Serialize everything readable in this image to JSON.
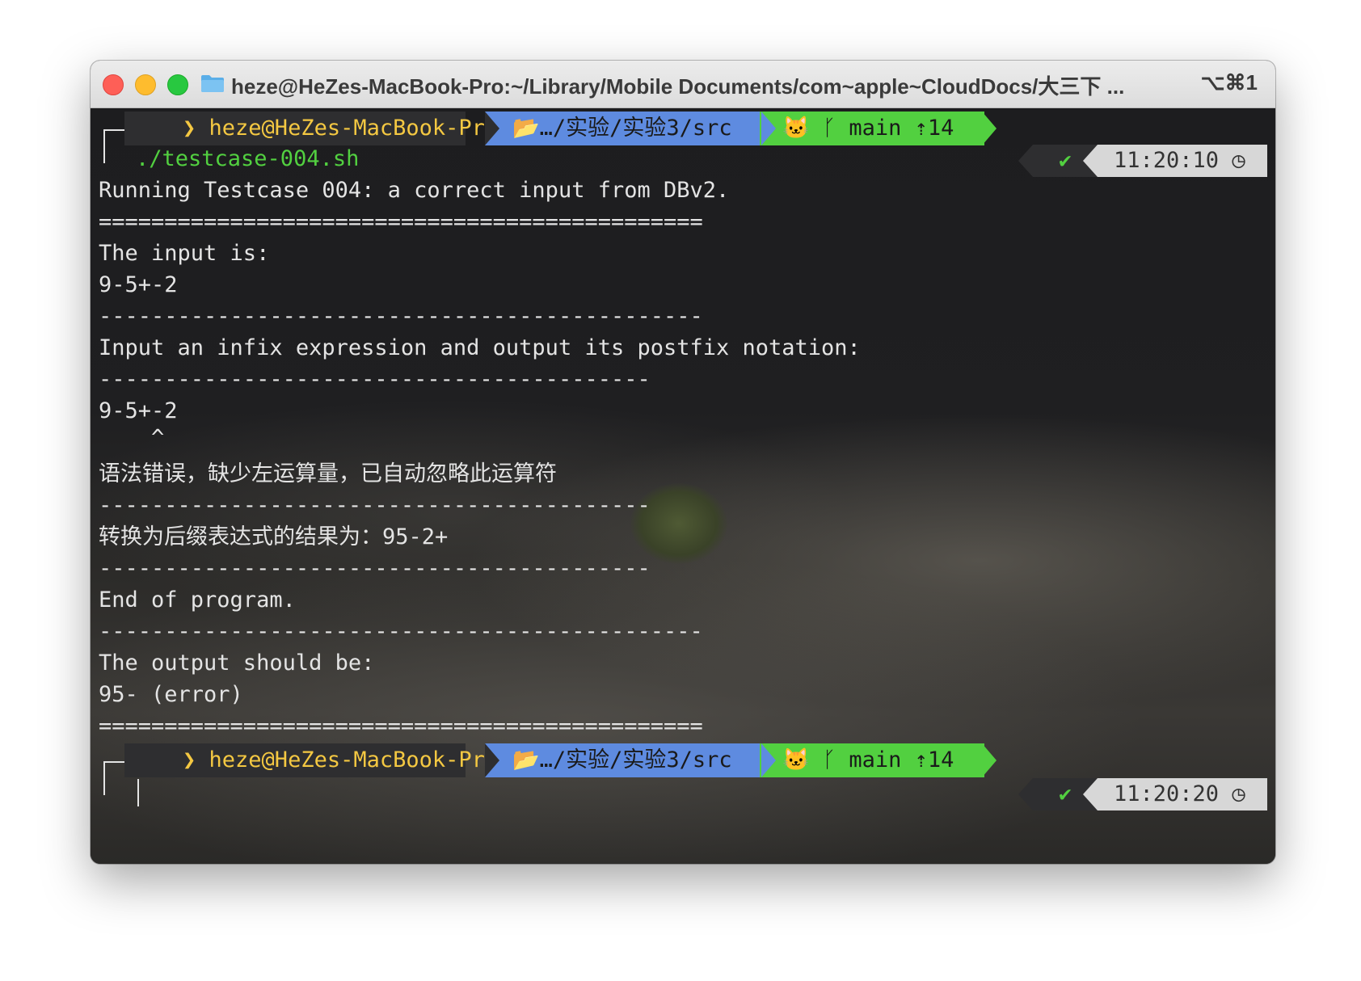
{
  "window": {
    "title": "heze@HeZes-MacBook-Pro:~/Library/Mobile Documents/com~apple~CloudDocs/大三下 ...",
    "shortcut": "⌥⌘1"
  },
  "prompt1": {
    "user": "heze@HeZes-MacBook-Pro",
    "dir": "…/实验/实验3/src",
    "branch": "main",
    "ahead": "14",
    "command": "./testcase-004.sh",
    "time": "11:20:10"
  },
  "output": [
    "Running Testcase 004: a correct input from DBv2.",
    "==============================================",
    "The input is:",
    "9-5+-2",
    "----------------------------------------------",
    "Input an infix expression and output its postfix notation:",
    "------------------------------------------",
    "9-5+-2",
    "    ^",
    "语法错误，缺少左运算量，已自动忽略此运算符",
    "------------------------------------------",
    "转换为后缀表达式的结果为：95-2+",
    "------------------------------------------",
    "End of program.",
    "----------------------------------------------",
    "The output should be:",
    "95- (error)",
    "=============================================="
  ],
  "prompt2": {
    "user": "heze@HeZes-MacBook-Pro",
    "dir": "…/实验/实验3/src",
    "branch": "main",
    "ahead": "14",
    "time": "11:20:20"
  },
  "colors": {
    "user_segment_text": "#f4c842",
    "dir_segment_bg": "#5e8be0",
    "git_segment_bg": "#52d040",
    "command_text": "#52d040",
    "output_text": "#e4e4e4"
  }
}
